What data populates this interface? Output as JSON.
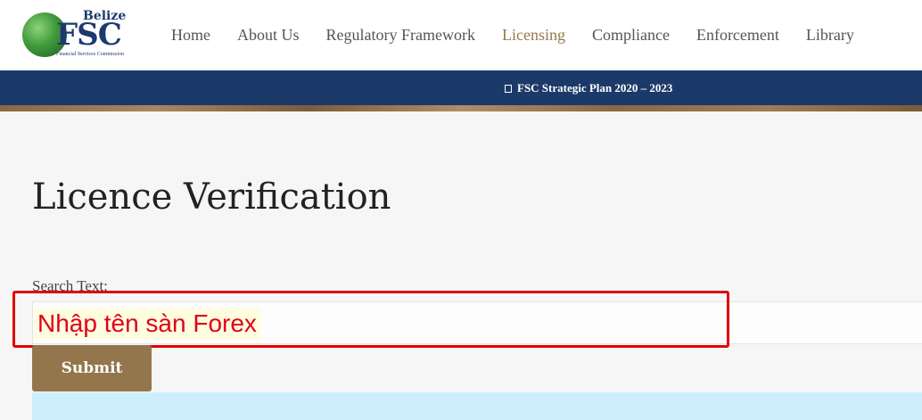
{
  "brand": {
    "country": "Belize",
    "abbr": "FSC",
    "full_name": "Financial Services Commission"
  },
  "nav": {
    "items": [
      {
        "label": "Home",
        "active": false
      },
      {
        "label": "About Us",
        "active": false
      },
      {
        "label": "Regulatory Framework",
        "active": false
      },
      {
        "label": "Licensing",
        "active": true
      },
      {
        "label": "Compliance",
        "active": false
      },
      {
        "label": "Enforcement",
        "active": false
      },
      {
        "label": "Library",
        "active": false
      }
    ]
  },
  "banner": {
    "link_label": "FSC Strategic Plan 2020 – 2023",
    "icon": "document-icon"
  },
  "page": {
    "title": "Licence Verification"
  },
  "search": {
    "label": "Search Text:",
    "value": "",
    "overlay_text": "Nhập tên sàn Forex"
  },
  "submit": {
    "label": "Submit"
  },
  "colors": {
    "navy": "#1c3a69",
    "accent_gold": "#96784a",
    "annotation_red": "#e00000",
    "results_bg": "#cdeffd"
  }
}
